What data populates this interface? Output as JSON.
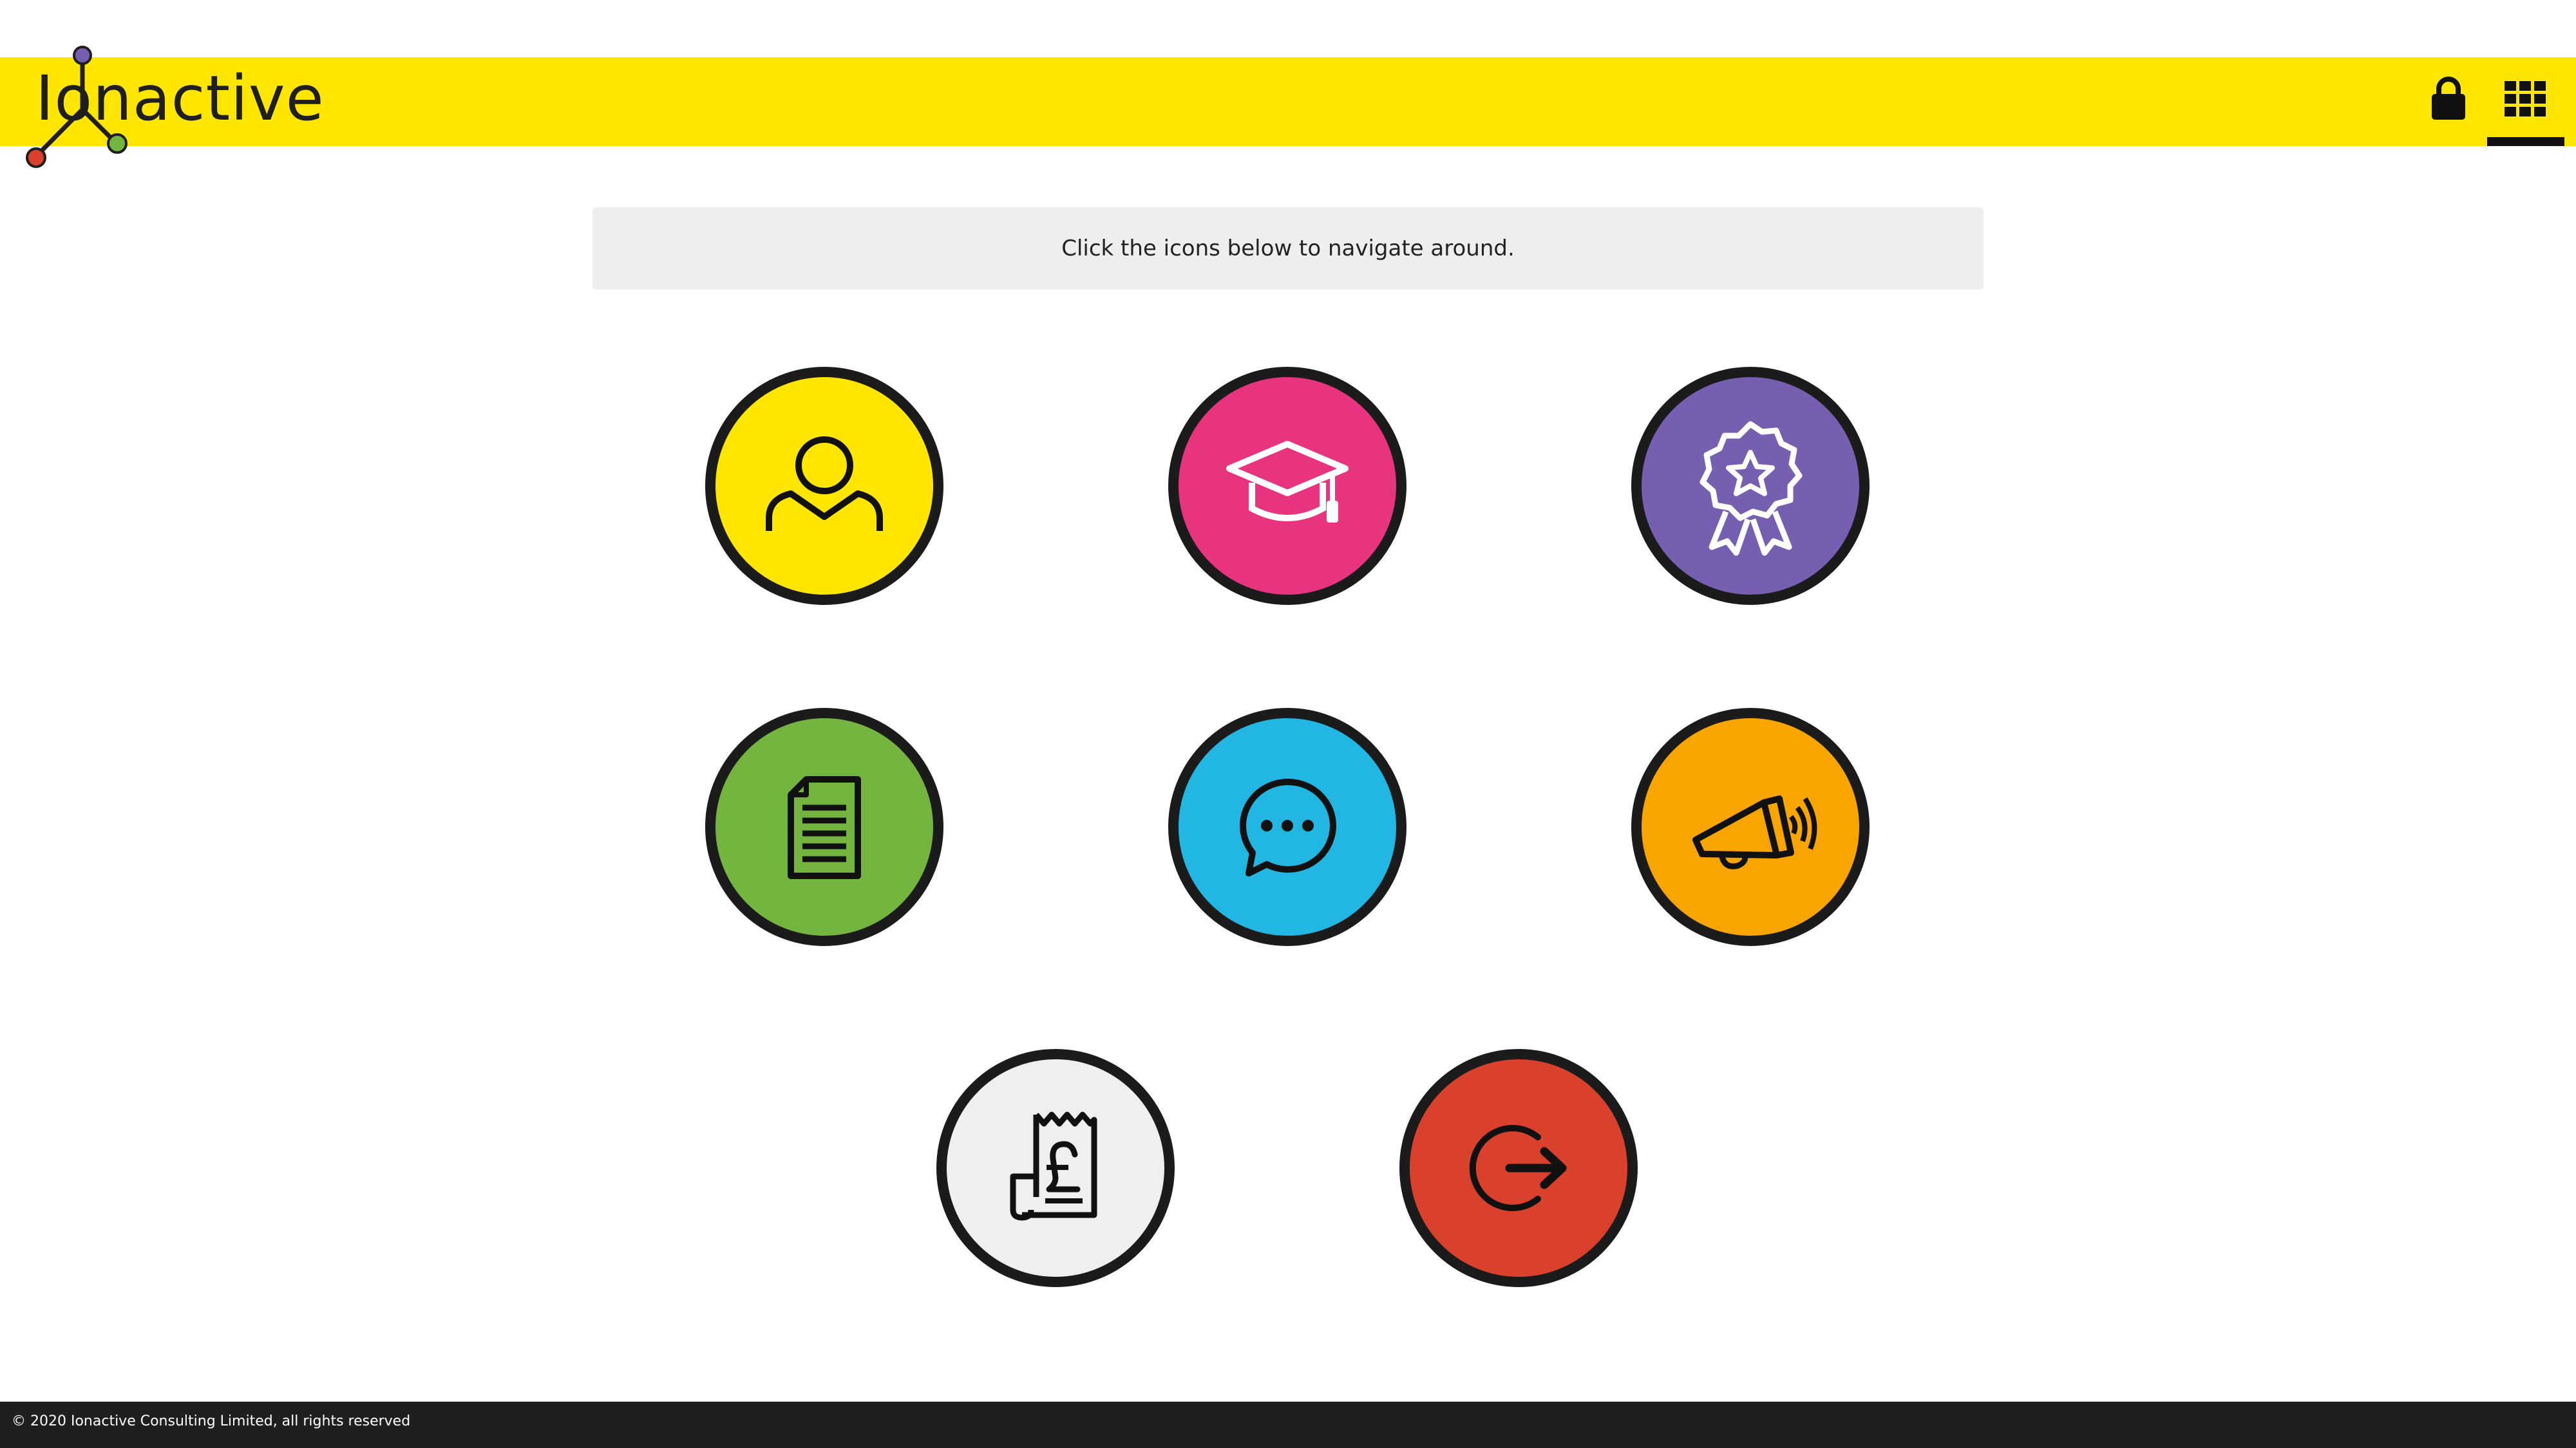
{
  "brand": {
    "name": "Ionactive",
    "primary_color": "#FFE600"
  },
  "header": {
    "lock_icon": "lock-icon",
    "apps_icon": "grid-icon"
  },
  "banner": {
    "text": "Click the icons below to navigate around."
  },
  "tiles": [
    {
      "icon": "user-icon",
      "color": "#FFE600"
    },
    {
      "icon": "graduation-cap-icon",
      "color": "#E8347F"
    },
    {
      "icon": "award-ribbon-icon",
      "color": "#765EB0"
    },
    {
      "icon": "document-icon",
      "color": "#74B540"
    },
    {
      "icon": "chat-bubble-icon",
      "color": "#22B6E3"
    },
    {
      "icon": "megaphone-icon",
      "color": "#F8A500"
    },
    {
      "icon": "receipt-pound-icon",
      "color": "#EFEFEF"
    },
    {
      "icon": "logout-icon",
      "color": "#D9412C"
    }
  ],
  "footer": {
    "copyright": "© 2020 Ionactive Consulting Limited, all rights reserved"
  }
}
